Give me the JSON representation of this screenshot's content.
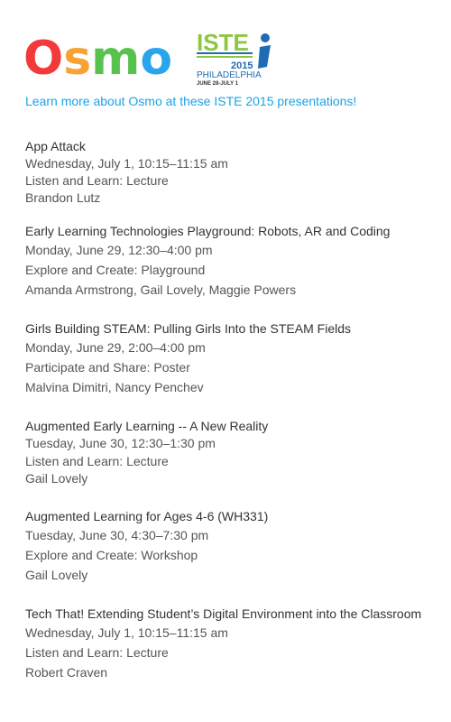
{
  "header": {
    "osmo_logo_text": "Osmo",
    "iste_logo": {
      "name": "ISTE",
      "year": "2015",
      "city": "PHILADELPHIA",
      "dates": "JUNE 28-JULY 1"
    }
  },
  "promo_link": "Learn more about Osmo at these ISTE 2015 presentations!",
  "colors": {
    "link": "#1aa3e8",
    "text": "#333333",
    "osmo_red": "#f23a3a",
    "osmo_orange": "#f7a234",
    "osmo_green": "#58c24f",
    "osmo_blue": "#2aa5ec",
    "iste_green": "#8dc63f",
    "iste_blue": "#1c6db5"
  },
  "sessions": [
    {
      "title": "App Attack",
      "date": "Wednesday, July 1, 10:15–11:15 am",
      "format": "Listen and Learn: Lecture",
      "presenters": "Brandon Lutz"
    },
    {
      "title": "Early Learning Technologies Playground: Robots, AR and Coding",
      "date": "Monday, June 29, 12:30–4:00 pm",
      "format": "Explore and Create: Playground",
      "presenters": "Amanda Armstrong, Gail Lovely, Maggie Powers"
    },
    {
      "title": "Girls Building STEAM: Pulling Girls Into the STEAM Fields",
      "date": "Monday, June 29, 2:00–4:00 pm",
      "format": "Participate and Share: Poster",
      "presenters": "Malvina Dimitri, Nancy Penchev"
    },
    {
      "title": "Augmented Early Learning -- A New Reality",
      "date": "Tuesday, June 30, 12:30–1:30 pm",
      "format": "Listen and Learn: Lecture",
      "presenters": "Gail Lovely"
    },
    {
      "title": "Augmented Learning for Ages 4-6 (WH331)",
      "date": "Tuesday, June 30, 4:30–7:30 pm",
      "format": "Explore and Create: Workshop",
      "presenters": "Gail Lovely"
    },
    {
      "title": "Tech That! Extending Student’s Digital Environment into the Classroom",
      "date": "Wednesday, July 1, 10:15–11:15 am",
      "format": "Listen and Learn: Lecture",
      "presenters": "Robert Craven"
    }
  ]
}
